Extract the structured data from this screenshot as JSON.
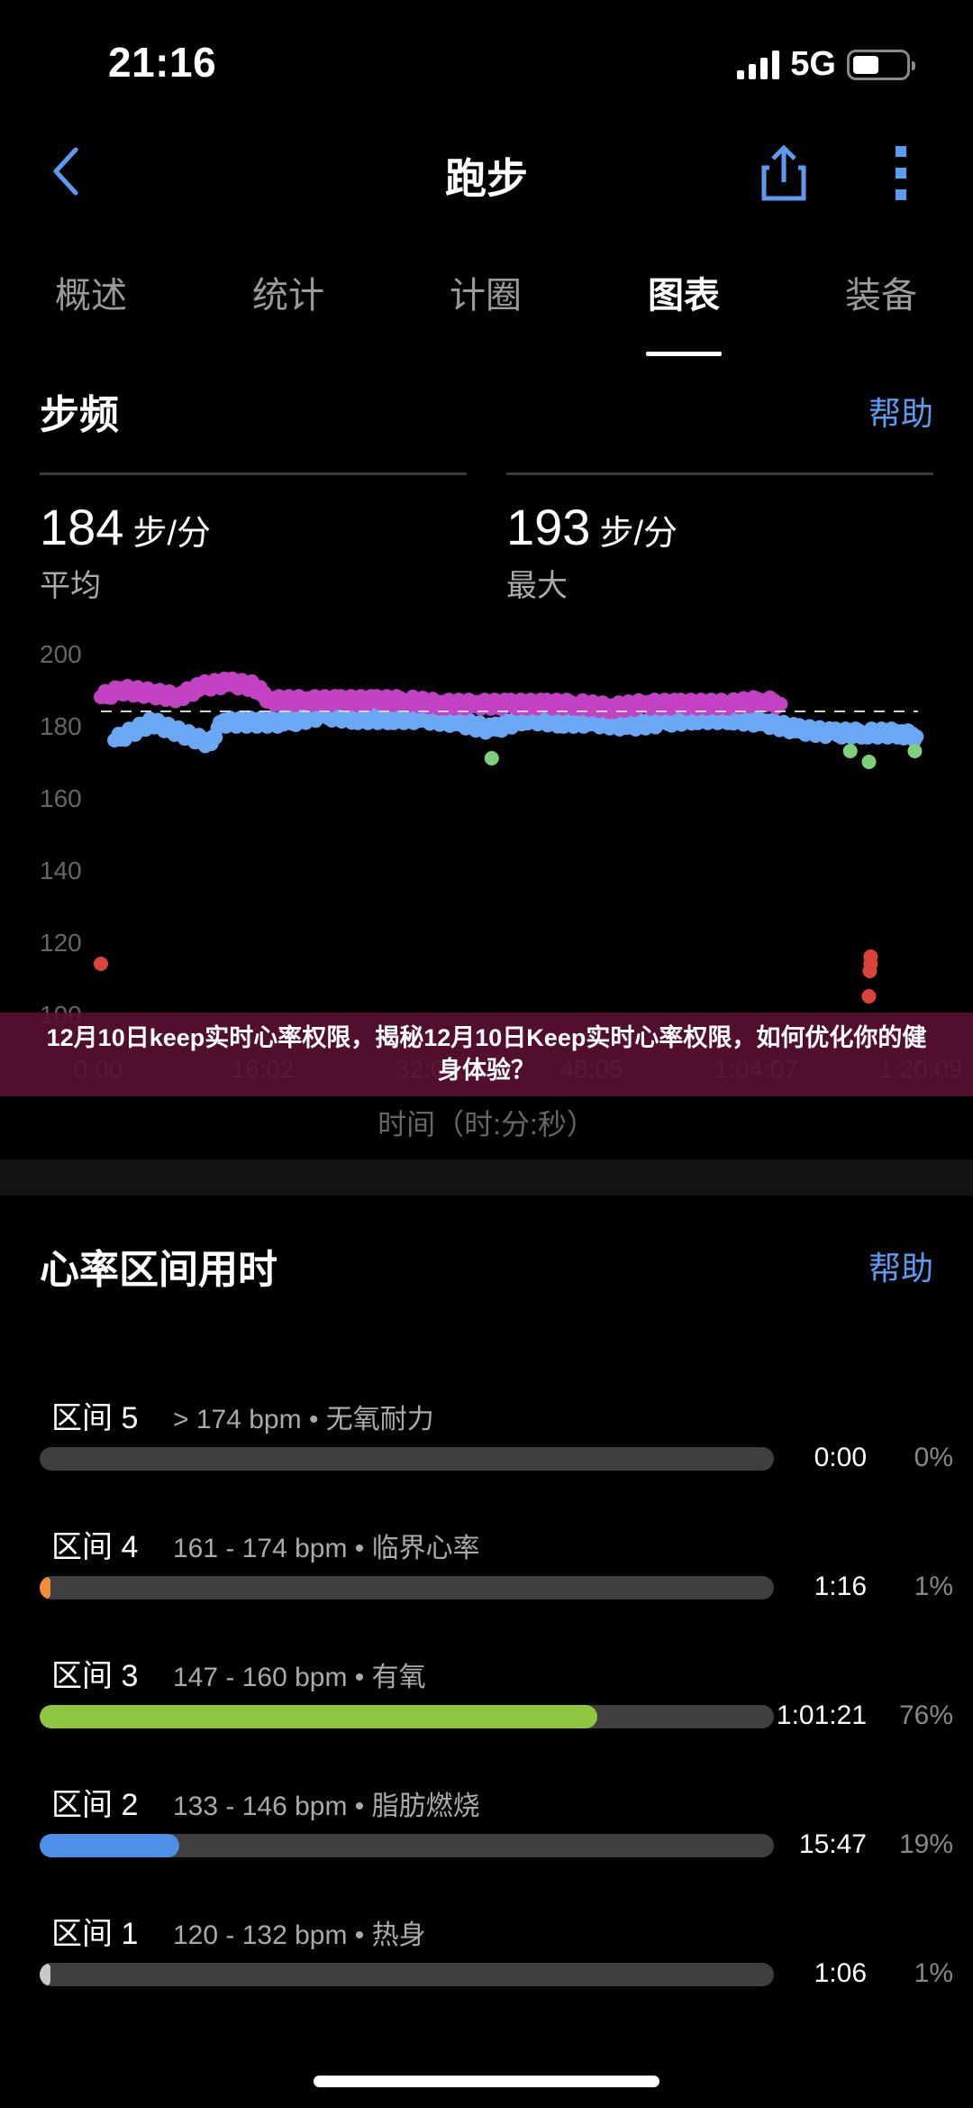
{
  "status_bar": {
    "time": "21:16",
    "network": "5G",
    "battery_level": 0.5
  },
  "nav": {
    "title": "跑步",
    "back_icon": "chevron-left-icon",
    "share_icon": "share-icon",
    "more_icon": "more-vertical-icon"
  },
  "tabs": [
    {
      "label": "概述",
      "active": false
    },
    {
      "label": "统计",
      "active": false
    },
    {
      "label": "计圈",
      "active": false
    },
    {
      "label": "图表",
      "active": true
    },
    {
      "label": "装备",
      "active": false
    }
  ],
  "cadence": {
    "title": "步频",
    "help": "帮助",
    "avg": {
      "value": "184",
      "unit": "步/分",
      "label": "平均"
    },
    "max": {
      "value": "193",
      "unit": "步/分",
      "label": "最大"
    }
  },
  "chart_data": {
    "type": "scatter",
    "title": "步频",
    "xlabel": "时间（时:分:秒）",
    "ylabel": "",
    "ylim": [
      100,
      200
    ],
    "xlim": [
      0,
      4809
    ],
    "yticks": [
      "200",
      "180",
      "160",
      "140",
      "120",
      "100"
    ],
    "xticks": [
      "0:00",
      "16:02",
      "32:04",
      "48:05",
      "1:04:07",
      "1:20:09"
    ],
    "reference_line": {
      "value": 184,
      "style": "dashed",
      "label": "平均"
    },
    "series": [
      {
        "name": "high",
        "color": "#c342c3",
        "points": [
          [
            0,
            188
          ],
          [
            120,
            190
          ],
          [
            300,
            189
          ],
          [
            450,
            188
          ],
          [
            600,
            191
          ],
          [
            750,
            192
          ],
          [
            900,
            191
          ],
          [
            1000,
            187
          ],
          [
            1200,
            187
          ],
          [
            1400,
            187
          ],
          [
            1600,
            187
          ],
          [
            1800,
            187
          ],
          [
            2000,
            186
          ],
          [
            2200,
            186
          ],
          [
            2400,
            186
          ],
          [
            2600,
            186
          ],
          [
            2800,
            186
          ],
          [
            3000,
            185
          ],
          [
            3200,
            186
          ],
          [
            3400,
            186
          ],
          [
            3700,
            186
          ],
          [
            3900,
            187
          ],
          [
            4000,
            186
          ]
        ]
      },
      {
        "name": "mid",
        "color": "#6aa8f5",
        "points": [
          [
            80,
            176
          ],
          [
            300,
            181
          ],
          [
            650,
            175
          ],
          [
            700,
            181
          ],
          [
            1100,
            181
          ],
          [
            1300,
            183
          ],
          [
            1500,
            182
          ],
          [
            1700,
            182
          ],
          [
            1900,
            182
          ],
          [
            2100,
            181
          ],
          [
            2300,
            179
          ],
          [
            2500,
            182
          ],
          [
            2700,
            181
          ],
          [
            2900,
            181
          ],
          [
            3100,
            180
          ],
          [
            3300,
            181
          ],
          [
            3500,
            182
          ],
          [
            3700,
            182
          ],
          [
            3900,
            181
          ],
          [
            4100,
            179
          ],
          [
            4300,
            178
          ],
          [
            4500,
            178
          ],
          [
            4700,
            178
          ],
          [
            4800,
            177
          ]
        ]
      },
      {
        "name": "low",
        "color": "#7ed07a",
        "points": [
          [
            2300,
            171
          ],
          [
            4410,
            173
          ],
          [
            4520,
            170
          ],
          [
            4790,
            173
          ]
        ]
      },
      {
        "name": "very-low",
        "color": "#d9433a",
        "points": [
          [
            0,
            114
          ],
          [
            4530,
            116
          ],
          [
            4530,
            114
          ],
          [
            4525,
            112
          ],
          [
            4520,
            105
          ]
        ]
      }
    ]
  },
  "banner": {
    "text": "12月10日keep实时心率权限，揭秘12月10日Keep实时心率权限，如何优化你的健身体验？"
  },
  "hr_zones": {
    "title": "心率区间用时",
    "help": "帮助",
    "zones": [
      {
        "name": "区间 5",
        "range": "> 174 bpm • 无氧耐力",
        "time": "0:00",
        "percent": "0%",
        "fraction": 0,
        "color": "#3f3f3f"
      },
      {
        "name": "区间 4",
        "range": "161 - 174 bpm • 临界心率",
        "time": "1:16",
        "percent": "1%",
        "fraction": 0.01,
        "color": "#f08c3a"
      },
      {
        "name": "区间 3",
        "range": "147 - 160 bpm • 有氧",
        "time": "1:01:21",
        "percent": "76%",
        "fraction": 0.76,
        "color": "#8ec63f"
      },
      {
        "name": "区间 2",
        "range": "133 - 146 bpm • 脂肪燃烧",
        "time": "15:47",
        "percent": "19%",
        "fraction": 0.19,
        "color": "#4e8fe8"
      },
      {
        "name": "区间 1",
        "range": "120 - 132 bpm • 热身",
        "time": "1:06",
        "percent": "1%",
        "fraction": 0.01,
        "color": "#c8c8c8"
      }
    ]
  }
}
